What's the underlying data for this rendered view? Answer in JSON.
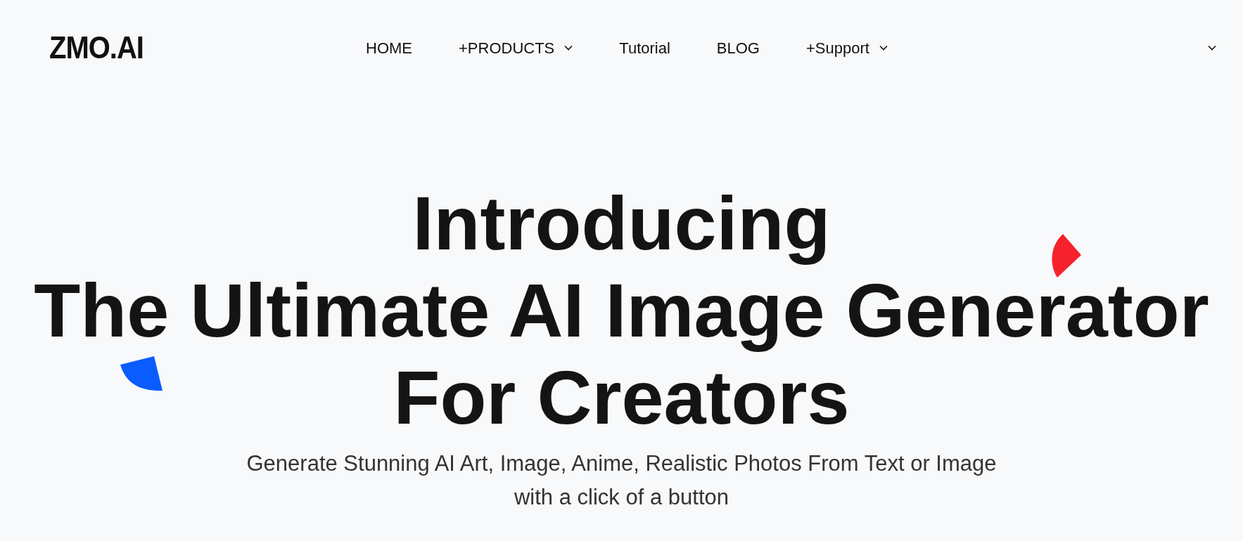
{
  "header": {
    "logo": "ZMO.AI",
    "nav": [
      {
        "label": "HOME",
        "dropdown": false
      },
      {
        "label": "+PRODUCTS",
        "dropdown": true
      },
      {
        "label": "Tutorial",
        "dropdown": false
      },
      {
        "label": "BLOG",
        "dropdown": false
      },
      {
        "label": "+Support",
        "dropdown": true
      }
    ],
    "menu_dropdown": true
  },
  "hero": {
    "headline": [
      "Introducing",
      "The Ultimate AI Image Generator",
      "For Creators"
    ],
    "subtitle": [
      "Generate Stunning AI Art, Image, Anime, Realistic Photos From Text or Image",
      "with a click of a button"
    ]
  }
}
